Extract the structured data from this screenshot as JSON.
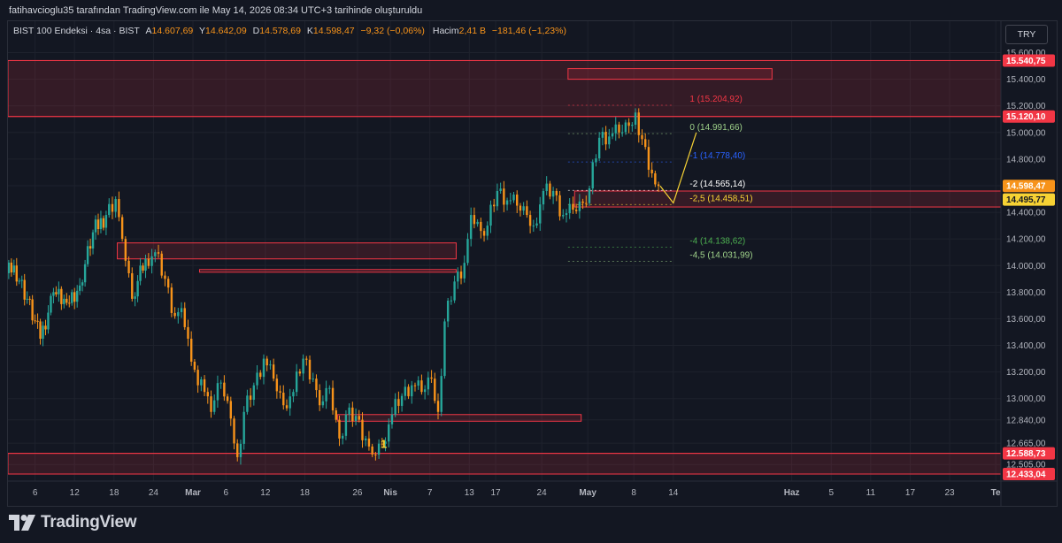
{
  "credit": "fatihavcioglu35 tarafından TradingView.com ile May 14, 2026 08:34 UTC+3 tarihinde oluşturuldu",
  "legend": {
    "symbol": "BIST 100 Endeksi · 4sa · BIST",
    "o_label": "A",
    "o": "14.607,69",
    "h_label": "Y",
    "h": "14.642,09",
    "l_label": "D",
    "l": "14.578,69",
    "c_label": "K",
    "c": "14.598,47",
    "change": "−9,32 (−0,06%)",
    "vol_label": "Hacim",
    "vol": "2,41 B",
    "vol_change": "−181,46 (−1,23%)"
  },
  "currency_button": "TRY",
  "brand": "TradingView",
  "colors": {
    "up": "#26a69a",
    "down": "#f7931a",
    "zone": "#f23645",
    "fib_yellow": "#f7d234"
  },
  "chart_data": {
    "type": "candlestick",
    "ylim": [
      12380,
      15650
    ],
    "y_ticks": [
      "15.600,00",
      "15.400,00",
      "15.200,00",
      "15.000,00",
      "14.800,00",
      "14.600,00",
      "14.400,00",
      "14.200,00",
      "14.000,00",
      "13.800,00",
      "13.600,00",
      "13.400,00",
      "13.200,00",
      "13.000,00",
      "12.840,00",
      "12.665,00",
      "12.505,00"
    ],
    "x_ticks": [
      {
        "label": "6",
        "d": 6
      },
      {
        "label": "12",
        "d": 12
      },
      {
        "label": "18",
        "d": 18
      },
      {
        "label": "24",
        "d": 24
      },
      {
        "label": "Mar",
        "d": 30
      },
      {
        "label": "6",
        "d": 35
      },
      {
        "label": "12",
        "d": 41
      },
      {
        "label": "18",
        "d": 47
      },
      {
        "label": "26",
        "d": 55
      },
      {
        "label": "Nis",
        "d": 60
      },
      {
        "label": "7",
        "d": 66
      },
      {
        "label": "13",
        "d": 72
      },
      {
        "label": "17",
        "d": 76
      },
      {
        "label": "24",
        "d": 83
      },
      {
        "label": "May",
        "d": 90
      },
      {
        "label": "8",
        "d": 97
      },
      {
        "label": "14",
        "d": 103
      },
      {
        "label": "Haz",
        "d": 121
      },
      {
        "label": "5",
        "d": 127
      },
      {
        "label": "11",
        "d": 133
      },
      {
        "label": "17",
        "d": 139
      },
      {
        "label": "23",
        "d": 145
      },
      {
        "label": "Te",
        "d": 152
      }
    ],
    "price_labels": [
      {
        "text": "15.540,75",
        "color": "#f23645",
        "v": 15540.75
      },
      {
        "text": "15.120,10",
        "color": "#f23645",
        "v": 15120.1
      },
      {
        "text": "14.598,47",
        "color": "#f7931a",
        "v": 14598.47
      },
      {
        "text": "14.495,77",
        "color": "#f7d234",
        "v": 14495.77
      },
      {
        "text": "12.588,73",
        "color": "#f23645",
        "v": 12588.73
      },
      {
        "text": "12.433,04",
        "color": "#f23645",
        "v": 12433.04
      }
    ],
    "fib_levels": [
      {
        "label": "1 (15.204,92)",
        "v": 15204.92,
        "color": "#f23645"
      },
      {
        "label": "0 (14.991,66)",
        "v": 14991.66,
        "color": "#9fd28a"
      },
      {
        "label": "-1 (14.778,40)",
        "v": 14778.4,
        "color": "#2962ff"
      },
      {
        "label": "-2 (14.565,14)",
        "v": 14565.14,
        "color": "#ffffff"
      },
      {
        "label": "-2,5 (14.458,51)",
        "v": 14458.51,
        "color": "#f7d234"
      },
      {
        "label": "-4 (14.138,62)",
        "v": 14138.62,
        "color": "#4caf50"
      },
      {
        "label": "-4,5 (14.031,99)",
        "v": 14031.99,
        "color": "#9fd28a"
      }
    ],
    "marker": {
      "text": "1",
      "d": 58.5,
      "v": 12630
    },
    "closes": [
      [
        1,
        13880
      ],
      [
        3,
        14000
      ],
      [
        5,
        13750
      ],
      [
        7,
        13450
      ],
      [
        9,
        13800
      ],
      [
        11,
        13720
      ],
      [
        13,
        13850
      ],
      [
        15,
        14250
      ],
      [
        17,
        14380
      ],
      [
        18.5,
        14500
      ],
      [
        19.5,
        14200
      ],
      [
        21,
        13750
      ],
      [
        23,
        14050
      ],
      [
        24.5,
        14100
      ],
      [
        26,
        13900
      ],
      [
        27.5,
        13620
      ],
      [
        28.5,
        13680
      ],
      [
        29.5,
        13450
      ],
      [
        31,
        13100
      ],
      [
        32,
        13050
      ],
      [
        33,
        12900
      ],
      [
        34.5,
        13120
      ],
      [
        36,
        12850
      ],
      [
        37,
        12560
      ],
      [
        38,
        12900
      ],
      [
        39.5,
        13100
      ],
      [
        41,
        13300
      ],
      [
        42.5,
        13150
      ],
      [
        44,
        12950
      ],
      [
        45.5,
        13050
      ],
      [
        47,
        13300
      ],
      [
        48.5,
        13150
      ],
      [
        49.5,
        12950
      ],
      [
        51,
        13080
      ],
      [
        52.5,
        12700
      ],
      [
        53.5,
        12880
      ],
      [
        55,
        12870
      ],
      [
        56.5,
        12700
      ],
      [
        57.5,
        12580
      ],
      [
        59,
        12660
      ],
      [
        60.5,
        12880
      ],
      [
        62,
        13020
      ],
      [
        63.5,
        13100
      ],
      [
        65,
        13050
      ],
      [
        66.5,
        13150
      ],
      [
        67.5,
        12900
      ],
      [
        68.5,
        13580
      ],
      [
        70,
        13880
      ],
      [
        71.5,
        14020
      ],
      [
        72.5,
        14380
      ],
      [
        74,
        14260
      ],
      [
        75,
        14300
      ],
      [
        76.5,
        14560
      ],
      [
        78,
        14490
      ],
      [
        79.5,
        14450
      ],
      [
        81,
        14380
      ],
      [
        82,
        14300
      ],
      [
        83.5,
        14560
      ],
      [
        85,
        14560
      ],
      [
        86.5,
        14380
      ],
      [
        88,
        14420
      ],
      [
        89.5,
        14470
      ],
      [
        90.5,
        14580
      ],
      [
        92,
        14960
      ],
      [
        93.5,
        14970
      ],
      [
        95,
        15000
      ],
      [
        96.5,
        15050
      ],
      [
        97.5,
        15150
      ],
      [
        98.5,
        14950
      ],
      [
        99.5,
        14720
      ],
      [
        100.5,
        14610
      ],
      [
        101,
        14598
      ]
    ],
    "zones": [
      {
        "d1": -10,
        "d2": 160,
        "v1": 15540.75,
        "v2": 15120.1
      },
      {
        "d1": 87,
        "d2": 118,
        "v1": 15480,
        "v2": 15400
      },
      {
        "d1": 88,
        "d2": 160,
        "v1": 14560,
        "v2": 14440
      },
      {
        "d1": 18.5,
        "d2": 70,
        "v1": 14170,
        "v2": 14050
      },
      {
        "d1": 31,
        "d2": 70,
        "v1": 13970,
        "v2": 13950
      },
      {
        "d1": 52,
        "d2": 89,
        "v1": 12880,
        "v2": 12830
      },
      {
        "d1": -10,
        "d2": 160,
        "v1": 12588.73,
        "v2": 12433.04
      }
    ],
    "projection": [
      [
        101,
        14598
      ],
      [
        103,
        14470
      ],
      [
        106.5,
        15000
      ]
    ]
  }
}
